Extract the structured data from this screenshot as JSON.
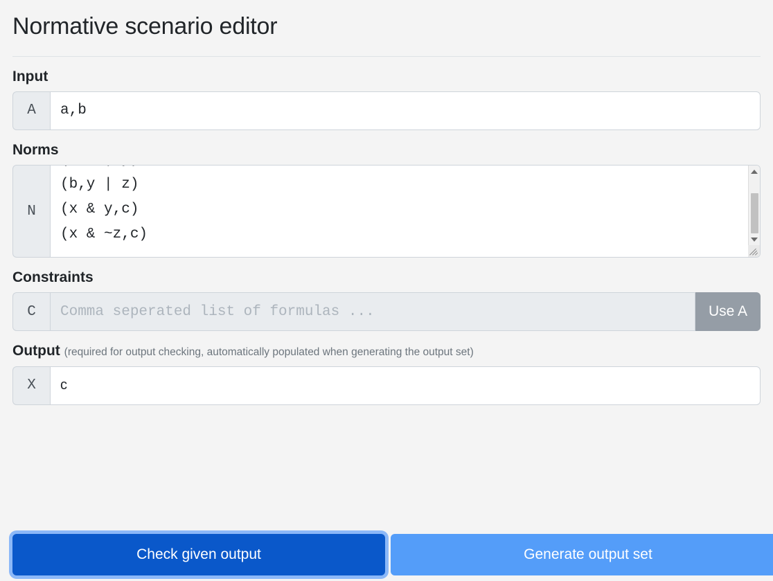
{
  "app": {
    "title": "Normative scenario editor",
    "background_color": "#f4f4f4"
  },
  "sections": {
    "input": {
      "label": "Input",
      "prefix": "A",
      "value": "a,b",
      "placeholder": ""
    },
    "norms": {
      "label": "Norms",
      "prefix": "N",
      "lines": [
        "(a,x | y)",
        "(b,y | z)",
        "(x & y,c)",
        "(x & ~z,c)"
      ],
      "value": "(a,x | y)\n(b,y | z)\n(x & y,c)\n(x & ~z,c)",
      "scrolled": true
    },
    "constraints": {
      "label": "Constraints",
      "prefix": "C",
      "value": "",
      "placeholder": "Comma seperated list of formulas ...",
      "use_a_button": "Use A",
      "disabled": true
    },
    "output": {
      "label": "Output",
      "hint": "(required for output checking, automatically populated when generating the output set)",
      "prefix": "X",
      "value": "c",
      "placeholder": ""
    }
  },
  "footer": {
    "check_button": "Check given output",
    "generate_button": "Generate output set",
    "check_button_color": "#0a58ca",
    "generate_button_color": "#549df9",
    "focus_ring_color": "#9ec5fe"
  }
}
